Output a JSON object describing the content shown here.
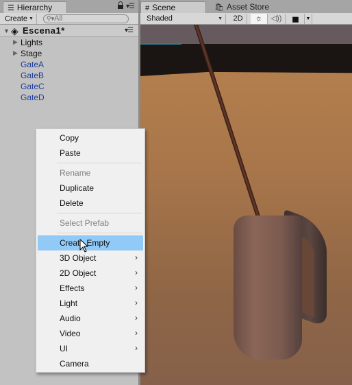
{
  "hierarchy": {
    "tab_label": "Hierarchy",
    "create_label": "Create",
    "search_placeholder": "All",
    "scene_name": "Escena1*",
    "items": [
      {
        "label": "Lights",
        "expandable": true,
        "prefab": false
      },
      {
        "label": "Stage",
        "expandable": true,
        "prefab": false
      },
      {
        "label": "GateA",
        "expandable": false,
        "prefab": true
      },
      {
        "label": "GateB",
        "expandable": false,
        "prefab": true
      },
      {
        "label": "GateC",
        "expandable": false,
        "prefab": true
      },
      {
        "label": "GateD",
        "expandable": false,
        "prefab": true
      }
    ]
  },
  "scene": {
    "tabs": [
      {
        "label": "Scene",
        "icon": "grid-icon",
        "active": true
      },
      {
        "label": "Asset Store",
        "icon": "store-bag-icon",
        "active": false
      }
    ],
    "toolbar": {
      "draw_mode": "Shaded",
      "mode_2d": "2D",
      "lighting_icon": "☼",
      "audio_icon": "🔊",
      "effects_icon": "▅"
    }
  },
  "context_menu": {
    "items": [
      {
        "label": "Copy",
        "disabled": false,
        "submenu": false
      },
      {
        "label": "Paste",
        "disabled": false,
        "submenu": false
      },
      {
        "separator": true
      },
      {
        "label": "Rename",
        "disabled": true,
        "submenu": false
      },
      {
        "label": "Duplicate",
        "disabled": false,
        "submenu": false
      },
      {
        "label": "Delete",
        "disabled": false,
        "submenu": false
      },
      {
        "separator": true
      },
      {
        "label": "Select Prefab",
        "disabled": true,
        "submenu": false
      },
      {
        "separator": true
      },
      {
        "label": "Create Empty",
        "disabled": false,
        "submenu": false,
        "highlighted": true
      },
      {
        "label": "3D Object",
        "disabled": false,
        "submenu": true
      },
      {
        "label": "2D Object",
        "disabled": false,
        "submenu": true
      },
      {
        "label": "Effects",
        "disabled": false,
        "submenu": true
      },
      {
        "label": "Light",
        "disabled": false,
        "submenu": true
      },
      {
        "label": "Audio",
        "disabled": false,
        "submenu": true
      },
      {
        "label": "Video",
        "disabled": false,
        "submenu": true
      },
      {
        "label": "UI",
        "disabled": false,
        "submenu": true
      },
      {
        "label": "Camera",
        "disabled": false,
        "submenu": false
      }
    ],
    "highlight_color": "#91c9f7"
  }
}
